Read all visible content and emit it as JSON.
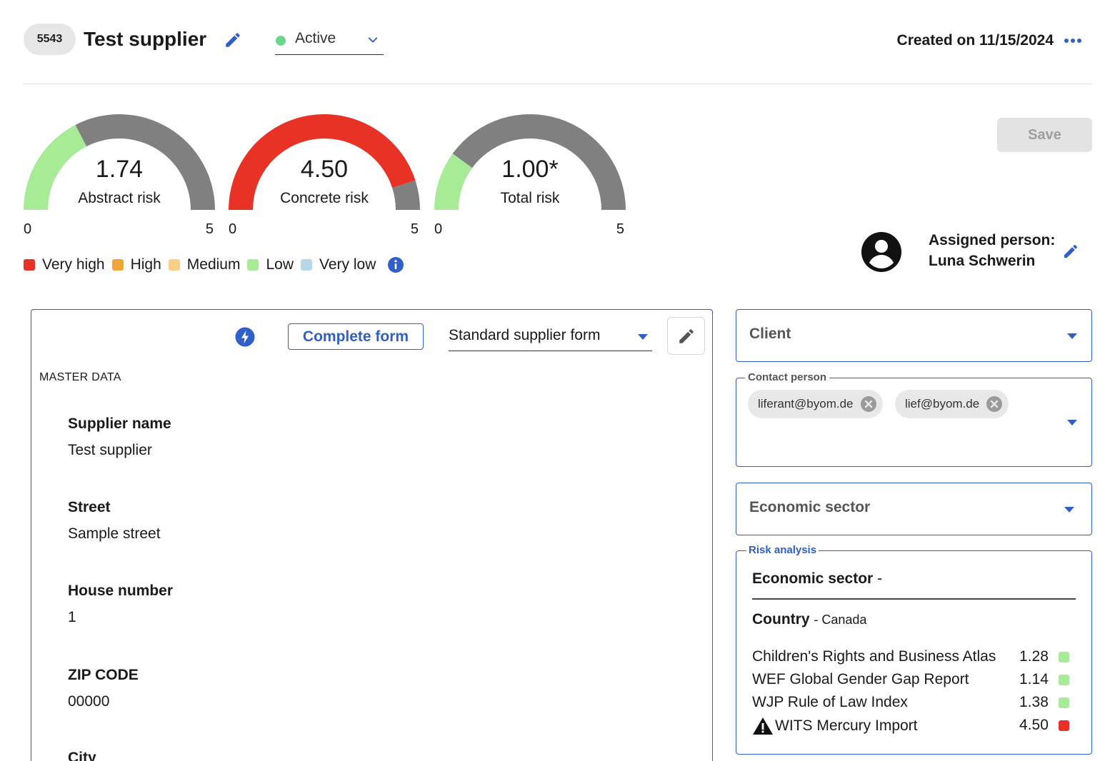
{
  "header": {
    "id": "5543",
    "title": "Test supplier",
    "status": "Active",
    "created": "Created on 11/15/2024"
  },
  "gauges": [
    {
      "value": 1.74,
      "value_label": "1.74",
      "label": "Abstract risk",
      "min": "0",
      "max": "5",
      "color": "#a8eb97"
    },
    {
      "value": 4.5,
      "value_label": "4.50",
      "label": "Concrete risk",
      "min": "0",
      "max": "5",
      "color": "#e83226"
    },
    {
      "value": 1.0,
      "value_label": "1.00*",
      "label": "Total risk",
      "min": "0",
      "max": "5",
      "color": "#a8eb97"
    }
  ],
  "legend": [
    {
      "label": "Very high",
      "color": "#e83226"
    },
    {
      "label": "High",
      "color": "#f0a53a"
    },
    {
      "label": "Medium",
      "color": "#f7cf86"
    },
    {
      "label": "Low",
      "color": "#a8eb97"
    },
    {
      "label": "Very low",
      "color": "#b6d8e6"
    }
  ],
  "save_label": "Save",
  "assigned": {
    "label": "Assigned person:",
    "name": "Luna Schwerin"
  },
  "form": {
    "complete_label": "Complete form",
    "template": "Standard supplier form",
    "section": "MASTER DATA",
    "fields": [
      {
        "label": "Supplier name",
        "value": "Test supplier"
      },
      {
        "label": "Street",
        "value": "Sample street"
      },
      {
        "label": "House number",
        "value": "1"
      },
      {
        "label": "ZIP CODE",
        "value": "00000"
      },
      {
        "label": "City",
        "value": ""
      }
    ]
  },
  "client": {
    "placeholder": "Client"
  },
  "contact": {
    "label": "Contact person",
    "chips": [
      "liferant@byom.de",
      "lief@byom.de"
    ]
  },
  "economic_sector": {
    "placeholder": "Economic sector"
  },
  "risk_analysis": {
    "title": "Risk analysis",
    "sector_label": "Economic sector",
    "sector_value": "-",
    "country_label": "Country",
    "country_value": "- Canada",
    "rows": [
      {
        "name": "Children's Rights and Business Atlas",
        "value": "1.28",
        "color": "#a8eb97",
        "warning": false
      },
      {
        "name": "WEF Global Gender Gap Report",
        "value": "1.14",
        "color": "#a8eb97",
        "warning": false
      },
      {
        "name": "WJP Rule of Law Index",
        "value": "1.38",
        "color": "#a8eb97",
        "warning": false
      },
      {
        "name": "WITS Mercury Import",
        "value": "4.50",
        "color": "#e83226",
        "warning": true
      }
    ]
  }
}
